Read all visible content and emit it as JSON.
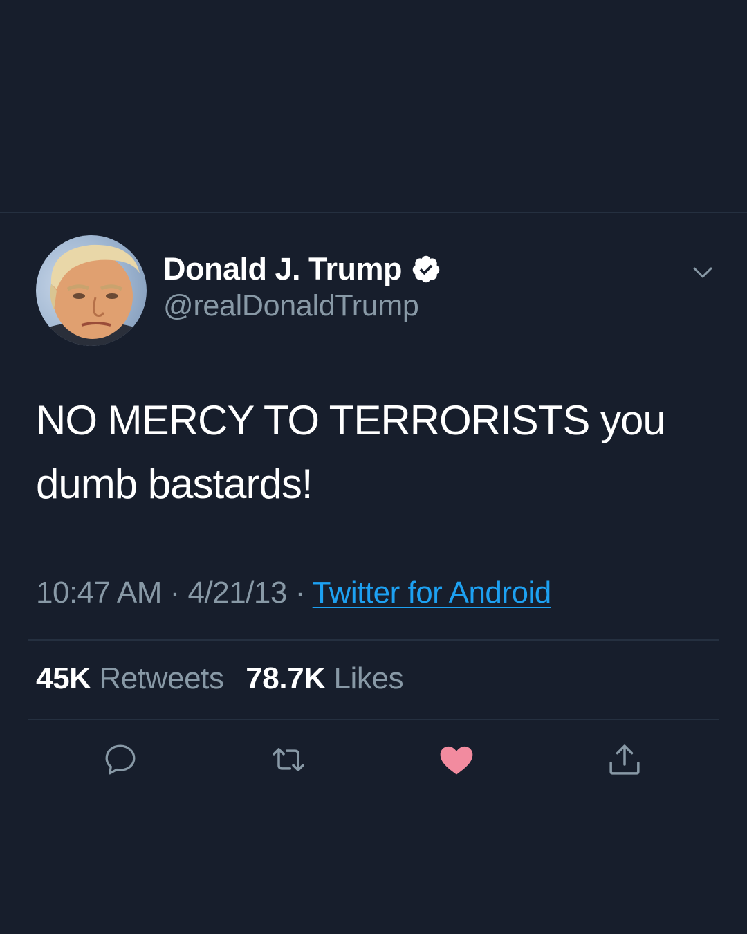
{
  "author": {
    "display_name": "Donald J. Trump",
    "handle": "@realDonaldTrump",
    "verified": true
  },
  "tweet": {
    "text": "NO MERCY TO TERRORISTS you dumb bastards!",
    "time": "10:47 AM",
    "date": "4/21/13",
    "separator": "·",
    "source": "Twitter for Android"
  },
  "stats": {
    "retweets_count": "45K",
    "retweets_label": "Retweets",
    "likes_count": "78.7K",
    "likes_label": "Likes"
  },
  "actions": {
    "reply": "reply-icon",
    "retweet": "retweet-icon",
    "like": "heart-icon",
    "share": "share-icon",
    "liked": true
  },
  "colors": {
    "background": "#171e2c",
    "text_primary": "#ffffff",
    "text_secondary": "#8899a6",
    "link": "#1da1f2",
    "like": "#f28b9f",
    "divider": "#253040"
  }
}
